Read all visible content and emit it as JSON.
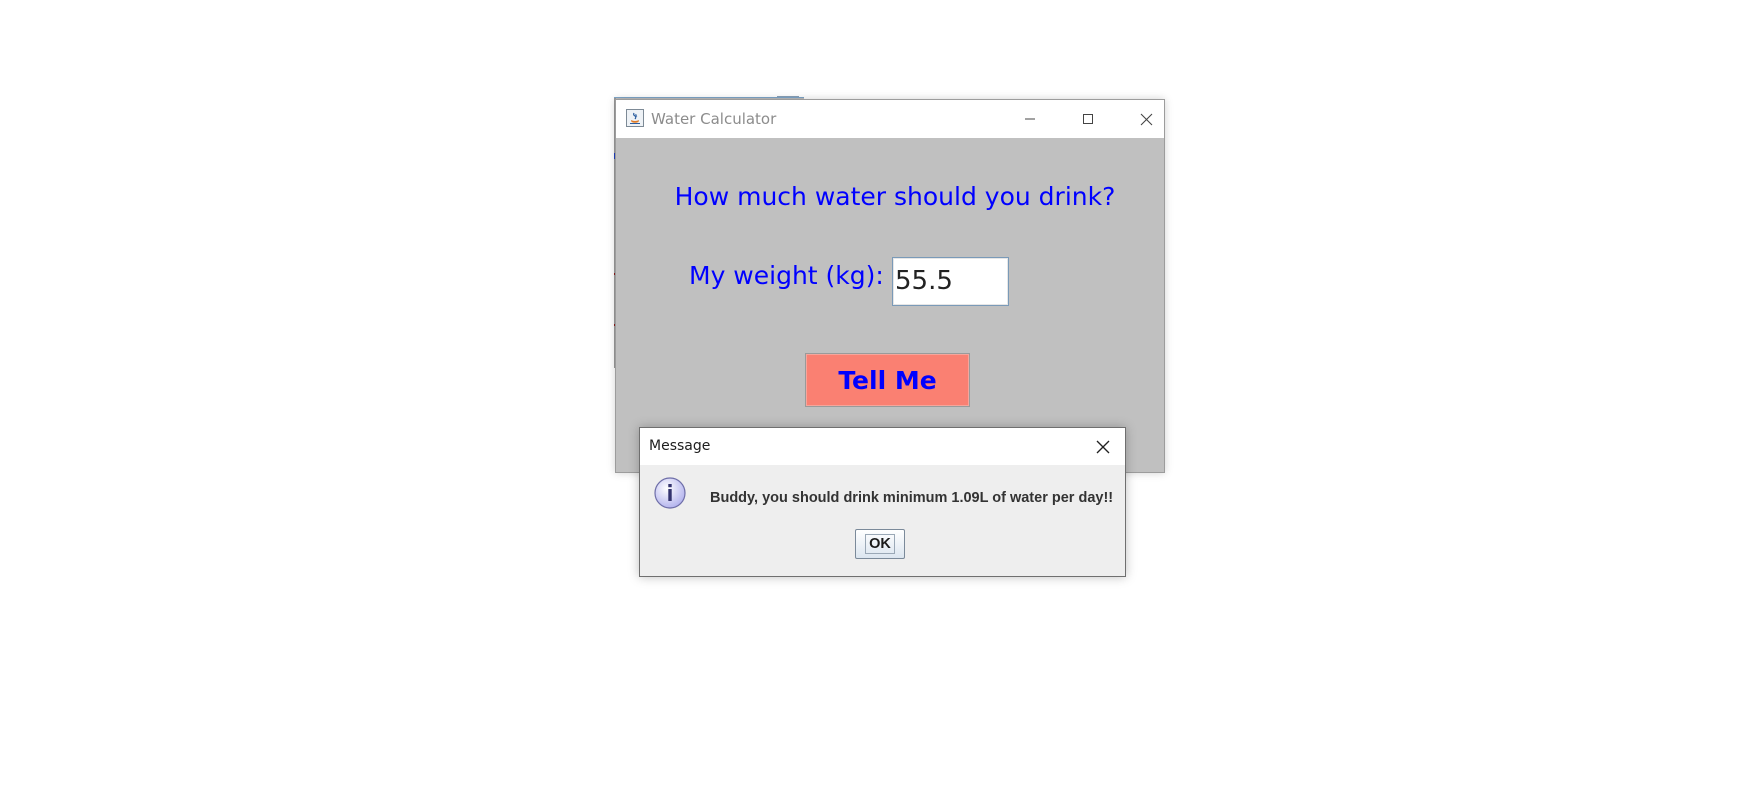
{
  "main_window": {
    "title": "Water Calculator",
    "heading": "How much water should you drink?",
    "weight_label": "My weight (kg):",
    "weight_value": "55.5",
    "button_label": "Tell Me",
    "colors": {
      "background": "#c0c0c0",
      "text": "#0000ff",
      "button_bg": "#fa8072"
    },
    "title_bar_icons": [
      "java-icon",
      "minimize-icon",
      "maximize-icon",
      "close-icon"
    ]
  },
  "dialog": {
    "title": "Message",
    "message": "Buddy, you should drink minimum 1.09L of water per day!!",
    "ok_label": "OK",
    "icon": "info-icon"
  }
}
